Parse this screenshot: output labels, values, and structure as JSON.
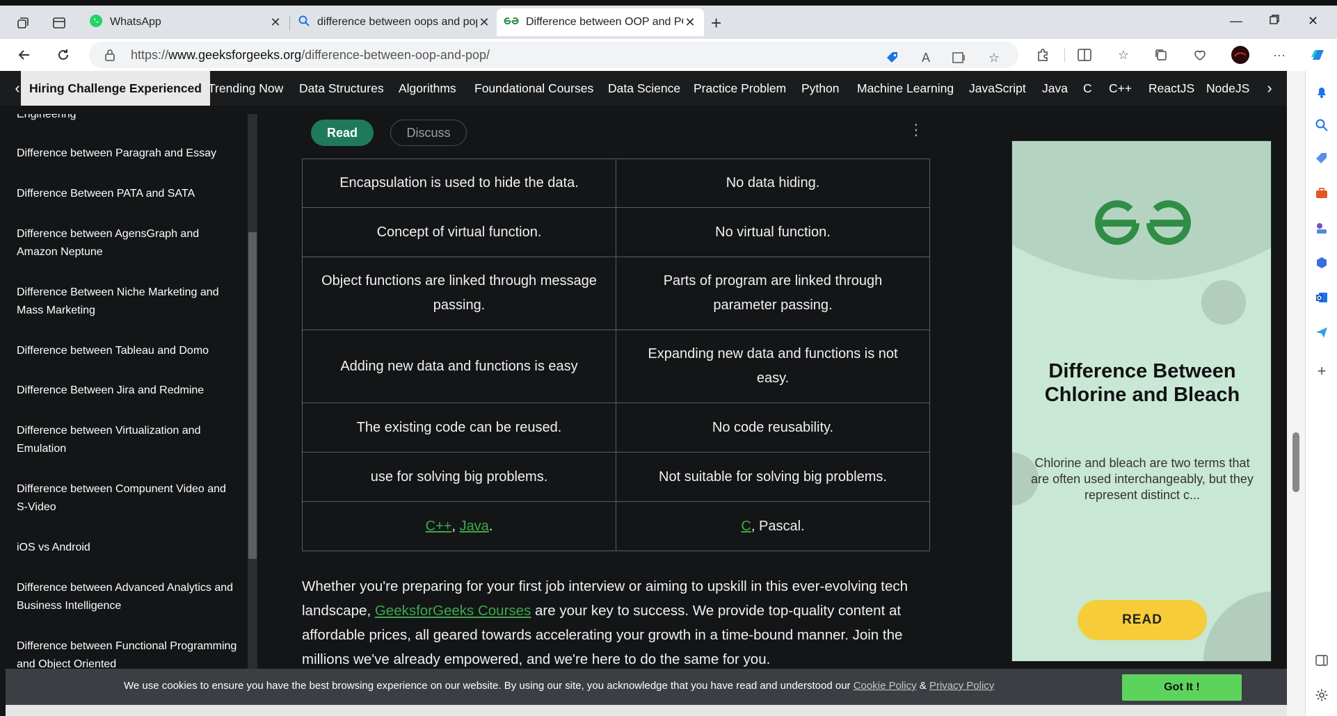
{
  "browser": {
    "tabs": [
      {
        "title": "WhatsApp",
        "icon": "whatsapp-icon"
      },
      {
        "title": "difference between oops and pop",
        "icon": "search-icon"
      },
      {
        "title": "Difference between OOP and POP",
        "icon": "gfg-icon"
      }
    ],
    "url": {
      "scheme": "https://",
      "host": "www.geeksforgeeks.org",
      "path": "/difference-between-oop-and-pop/"
    }
  },
  "categories": [
    "Hiring Challenge Experienced",
    "Trending Now",
    "Data Structures",
    "Algorithms",
    "Foundational Courses",
    "Data Science",
    "Practice Problem",
    "Python",
    "Machine Learning",
    "JavaScript",
    "Java",
    "C",
    "C++",
    "ReactJS",
    "NodeJS"
  ],
  "leftnav": {
    "items": [
      "Engineering",
      "Difference between Paragrah and Essay",
      "Difference Between PATA and SATA",
      "Difference between AgensGraph and Amazon Neptune",
      "Difference Between Niche Marketing and Mass Marketing",
      "Difference between Tableau and Domo",
      "Difference Between Jira and Redmine",
      "Difference between Virtualization and Emulation",
      "Difference between Compunent Video and S-Video",
      "iOS vs Android",
      "Difference between Advanced Analytics and Business Intelligence",
      "Difference between Functional Programming and Object Oriented"
    ]
  },
  "article": {
    "read_label": "Read",
    "discuss_label": "Discuss",
    "table": [
      [
        "Encapsulation is used to hide the data.",
        "No data hiding."
      ],
      [
        "Concept of virtual function.",
        "No virtual function."
      ],
      [
        "Object functions are linked through message passing.",
        "Parts of program are linked through parameter passing."
      ],
      [
        "Adding new data and functions is easy",
        "Expanding new data and functions is not easy."
      ],
      [
        "The existing code can be reused.",
        "No code reusability."
      ],
      [
        "use for solving big problems.",
        "Not suitable for solving big problems."
      ]
    ],
    "last_row": {
      "left_link1": "C++",
      "left_sep": ", ",
      "left_link2": "Java",
      "left_end": ".",
      "right_link": "C",
      "right_rest": ", Pascal."
    },
    "paragraph": {
      "before": "Whether you're preparing for your first job interview or aiming to upskill in this ever-evolving tech landscape, ",
      "link": "GeeksforGeeks Courses",
      "after": " are your key to success. We provide top-quality content at affordable prices, all geared towards accelerating your growth in a time-bound manner. Join the millions we've already empowered, and we're here to do the same for you."
    }
  },
  "ad": {
    "title": "Difference Between Chlorine and Bleach",
    "description": "Chlorine and bleach are two terms that are often used interchangeably, but they represent distinct c...",
    "button": "READ"
  },
  "cookie": {
    "message": "We use cookies to ensure you have the best browsing experience on our website. By using our site, you acknowledge that you have read and understood our ",
    "cookie_policy": "Cookie Policy",
    "amp": " & ",
    "privacy_policy": "Privacy Policy",
    "button": "Got It !"
  },
  "colors": {
    "accent_green": "#1f7a5a",
    "link_green": "#3fa84a",
    "got_it_green": "#5cd45c",
    "ad_button_yellow": "#f6cd38"
  }
}
